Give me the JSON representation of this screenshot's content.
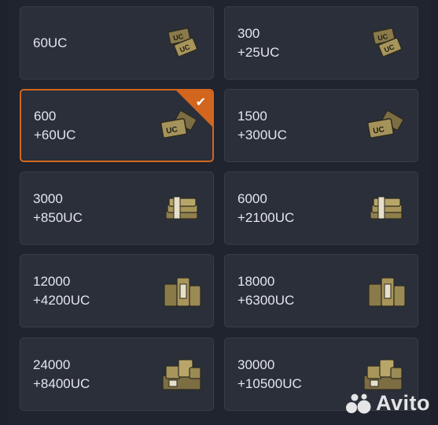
{
  "packages": [
    {
      "amount": "60UC",
      "bonus": "",
      "icon": "uc-cards-small-icon",
      "selected": false
    },
    {
      "amount": "300",
      "bonus": "+25UC",
      "icon": "uc-cards-small-icon",
      "selected": false
    },
    {
      "amount": "600",
      "bonus": "+60UC",
      "icon": "uc-cards-icon",
      "selected": true
    },
    {
      "amount": "1500",
      "bonus": "+300UC",
      "icon": "uc-cards-icon",
      "selected": false
    },
    {
      "amount": "3000",
      "bonus": "+850UC",
      "icon": "uc-bundle-icon",
      "selected": false
    },
    {
      "amount": "6000",
      "bonus": "+2100UC",
      "icon": "uc-bundle-icon",
      "selected": false
    },
    {
      "amount": "12000",
      "bonus": "+4200UC",
      "icon": "uc-stack-icon",
      "selected": false
    },
    {
      "amount": "18000",
      "bonus": "+6300UC",
      "icon": "uc-stack-icon",
      "selected": false
    },
    {
      "amount": "24000",
      "bonus": "+8400UC",
      "icon": "uc-pile-icon",
      "selected": false
    },
    {
      "amount": "30000",
      "bonus": "+10500UC",
      "icon": "uc-pile-icon",
      "selected": false
    }
  ],
  "colors": {
    "accent": "#d2661e",
    "card_bg": "#2a2f39",
    "text": "#e3e6ec"
  },
  "watermark": {
    "text": "Avito"
  }
}
